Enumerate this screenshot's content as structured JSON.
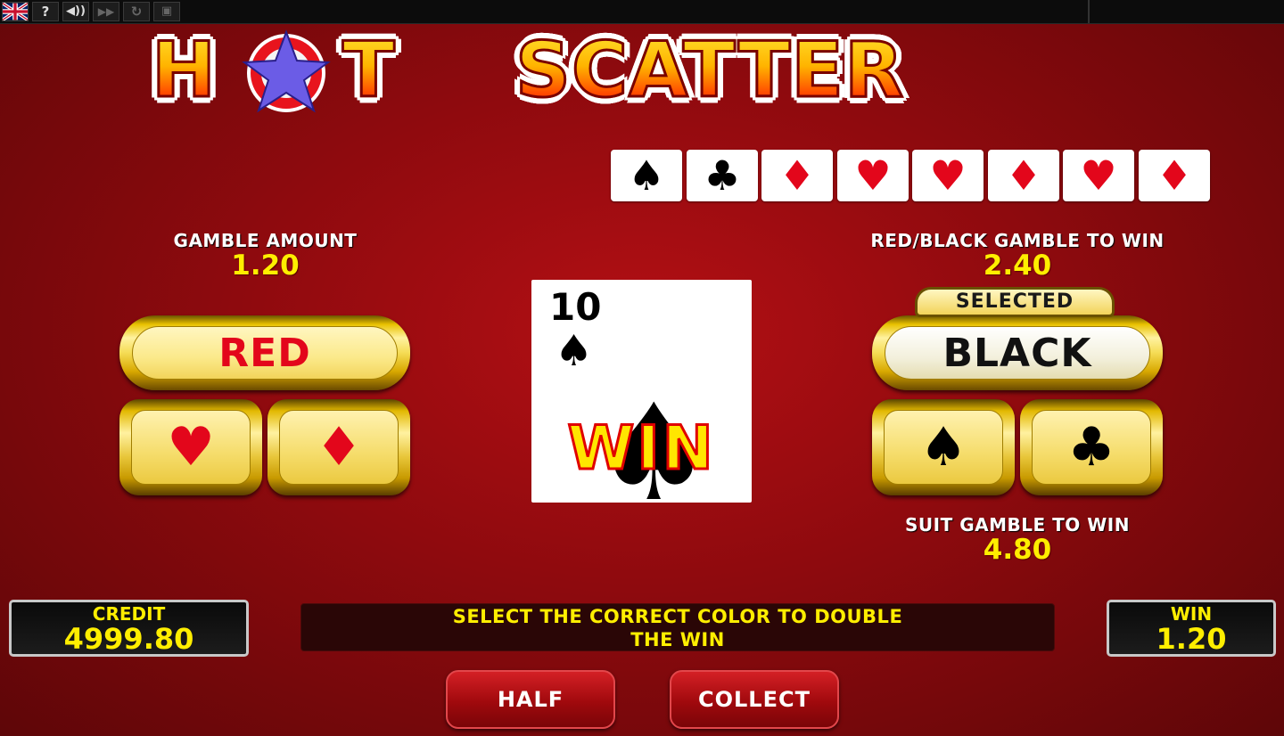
{
  "toolbar": {
    "language_icon": "uk-flag-icon",
    "help_label": "?",
    "sound_icon": "speaker-icon",
    "turbo_icon": "fast-forward-icon",
    "autoplay_icon": "refresh-icon",
    "window_icon": "window-icon"
  },
  "logo": {
    "word1_left": "H",
    "word1_right": "T",
    "word2": "SCATTER"
  },
  "history": [
    {
      "suit": "♠",
      "color": "black"
    },
    {
      "suit": "♣",
      "color": "black"
    },
    {
      "suit": "♦",
      "color": "red"
    },
    {
      "suit": "♥",
      "color": "red"
    },
    {
      "suit": "♥",
      "color": "red"
    },
    {
      "suit": "♦",
      "color": "red"
    },
    {
      "suit": "♥",
      "color": "red"
    },
    {
      "suit": "♦",
      "color": "red"
    }
  ],
  "gamble_amount": {
    "label": "GAMBLE AMOUNT",
    "value": "1.20"
  },
  "red_black": {
    "label": "RED/BLACK GAMBLE TO WIN",
    "value": "2.40"
  },
  "suit_gamble": {
    "label": "SUIT GAMBLE TO WIN",
    "value": "4.80"
  },
  "buttons": {
    "red": "RED",
    "black": "BLACK",
    "selected_badge": "SELECTED",
    "heart": "♥",
    "diamond": "♦",
    "spade": "♠",
    "club": "♣",
    "half": "HALF",
    "collect": "COLLECT"
  },
  "card": {
    "rank": "10",
    "suit": "♠",
    "result": "WIN"
  },
  "credit": {
    "label": "CREDIT",
    "value": "4999.80"
  },
  "win": {
    "label": "WIN",
    "value": "1.20"
  },
  "message": {
    "line1": "SELECT THE CORRECT COLOR TO DOUBLE",
    "line2": "THE WIN"
  },
  "colors": {
    "accent_yellow": "#ffee00",
    "suit_red": "#e3061b",
    "background_red": "#8e0a0e"
  }
}
